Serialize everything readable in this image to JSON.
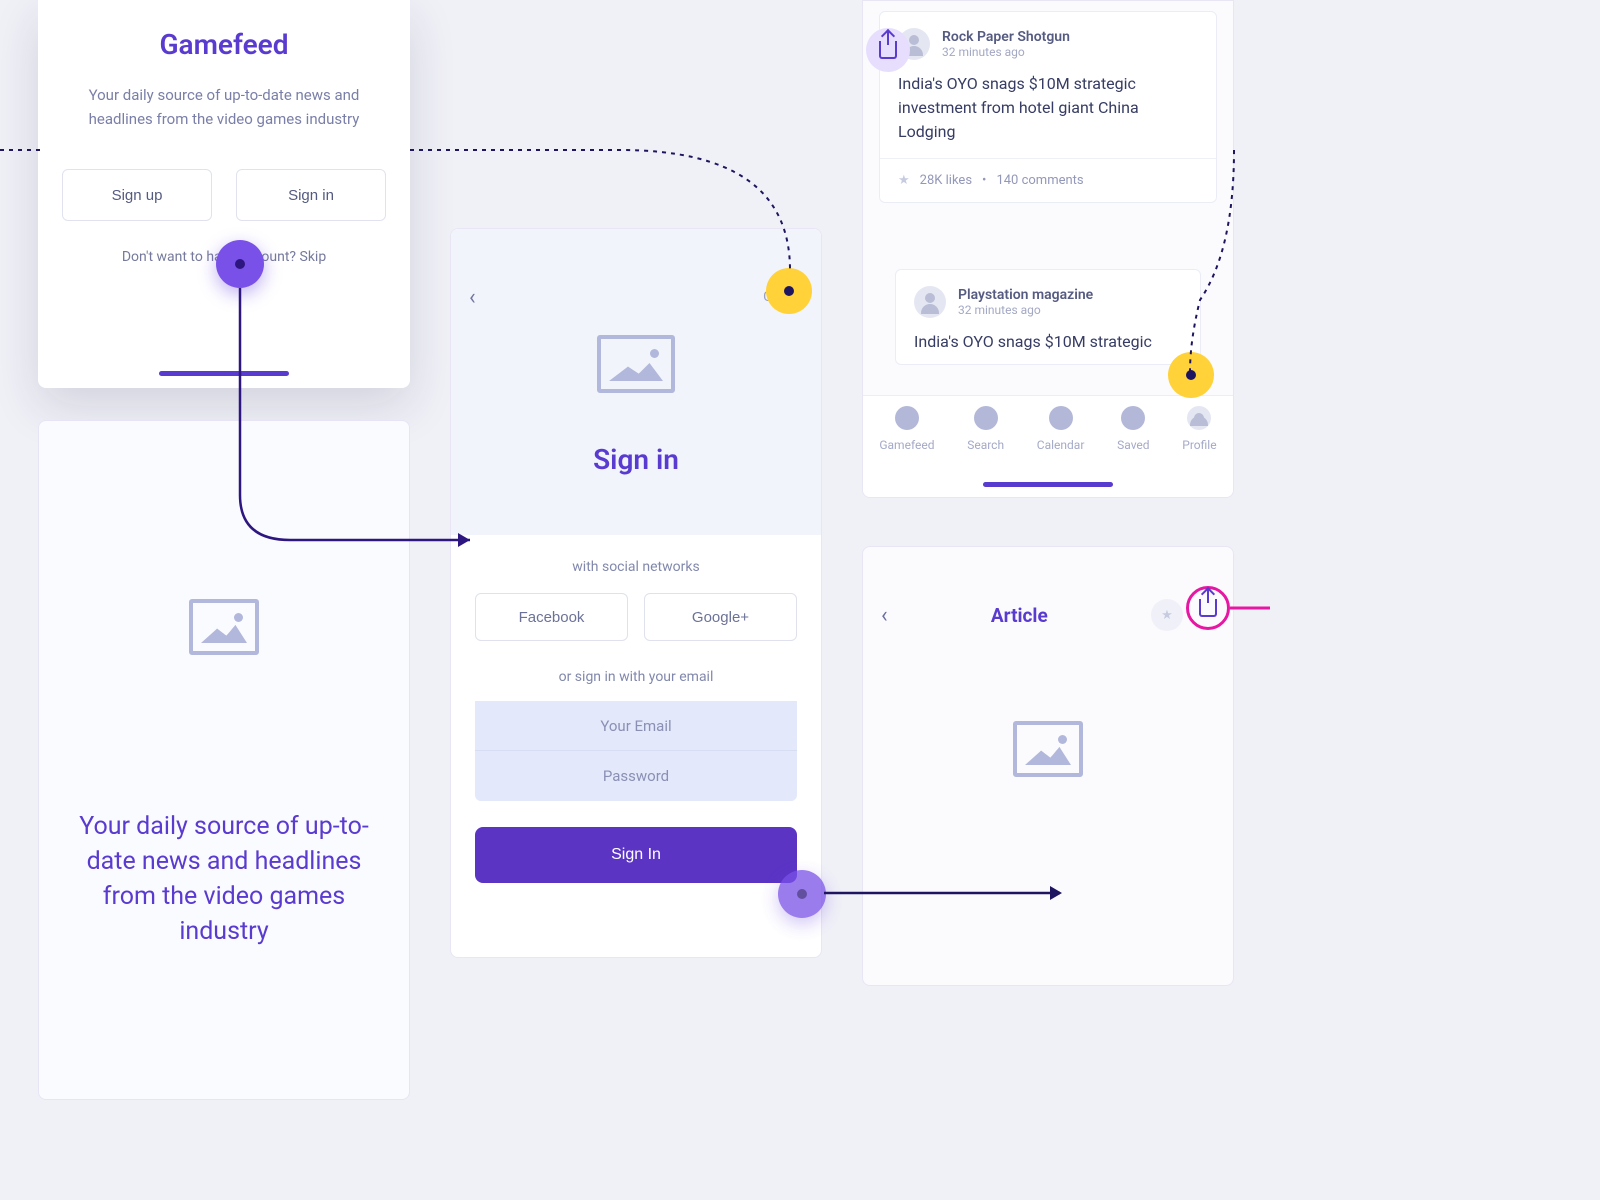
{
  "welcome": {
    "title": "Gamefeed",
    "description": "Your daily source of up-to-date news and headlines from the video games industry",
    "sign_up_label": "Sign up",
    "sign_in_label": "Sign in",
    "skip_prompt": "Don't want to have account? Skip"
  },
  "onboarding": {
    "tagline": "Your daily source of up-to-date news and headlines from the video games industry"
  },
  "signin": {
    "cover_label": "Cover",
    "title": "Sign in",
    "social_prompt": "with social networks",
    "facebook_label": "Facebook",
    "google_label": "Google+",
    "email_prompt": "or sign in with your email",
    "email_placeholder": "Your Email",
    "password_placeholder": "Password",
    "submit_label": "Sign In"
  },
  "feed": {
    "cards": [
      {
        "source": "Rock Paper Shotgun",
        "time": "32 minutes ago",
        "headline": "India's OYO snags $10M strategic investment from hotel giant China Lodging",
        "likes": "28K likes",
        "comments": "140 comments"
      },
      {
        "source": "Playstation magazine",
        "time": "32 minutes ago",
        "headline": "India's OYO snags $10M strategic"
      }
    ],
    "tabs": [
      {
        "label": "Gamefeed"
      },
      {
        "label": "Search"
      },
      {
        "label": "Calendar"
      },
      {
        "label": "Saved"
      },
      {
        "label": "Profile"
      }
    ]
  },
  "article": {
    "title": "Article"
  }
}
